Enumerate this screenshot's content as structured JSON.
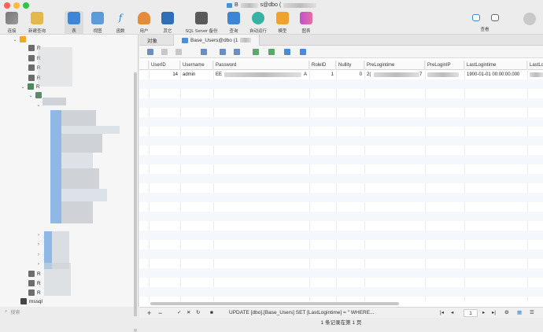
{
  "window": {
    "title_prefix": "B",
    "title_suffix": "s@dbo ("
  },
  "toolbar": {
    "items": [
      {
        "label": "连接",
        "icon": "connect-icon"
      },
      {
        "label": "新建查询",
        "icon": "new-query-icon"
      },
      {
        "label": "表",
        "icon": "table-icon"
      },
      {
        "label": "视图",
        "icon": "view-icon"
      },
      {
        "label": "函数",
        "icon": "function-icon"
      },
      {
        "label": "用户",
        "icon": "user-icon"
      },
      {
        "label": "其它",
        "icon": "other-icon"
      },
      {
        "label": "SQL Server 备份",
        "icon": "backup-icon"
      },
      {
        "label": "查询",
        "icon": "query-icon"
      },
      {
        "label": "自动运行",
        "icon": "automation-icon"
      },
      {
        "label": "模型",
        "icon": "model-icon"
      },
      {
        "label": "图表",
        "icon": "chart-icon"
      },
      {
        "label": "查看",
        "icon": "view-mode-icon"
      }
    ]
  },
  "sidebar": {
    "rows": [
      {
        "label": "R"
      },
      {
        "label": "R"
      },
      {
        "label": "R"
      },
      {
        "label": "R"
      },
      {
        "label": "R"
      },
      {
        "label": "R"
      },
      {
        "label": "R"
      },
      {
        "label": "R"
      }
    ],
    "mssql_label": "mssql",
    "search_placeholder": "搜索"
  },
  "tabs": {
    "objects": "对象",
    "table_tab": "Base_Users@dbo (1"
  },
  "grid": {
    "columns": [
      "UserID",
      "Username",
      "Password",
      "RoleID",
      "Nullity",
      "PreLogintime",
      "PreLoginIP",
      "LastLogintime",
      "LastLo"
    ],
    "row": {
      "userid": "14",
      "username": "admin",
      "password_start": "EE",
      "password_end": "A",
      "roleid": "1",
      "nullity": "0",
      "prelogintime": "2(",
      "preloginip": "7",
      "lastlogintime": "1900-01-01 00:00:00.000"
    }
  },
  "status": {
    "sql": "UPDATE [dbo].[Base_Users] SET [LastLogintime] = '' WHERE...",
    "page": "1",
    "record_info": "1 条记录在第 1 页"
  },
  "colors": {
    "accent": "#4a90d9",
    "close": "#fe5f57",
    "minimize": "#febc2e",
    "maximize": "#28c840"
  }
}
